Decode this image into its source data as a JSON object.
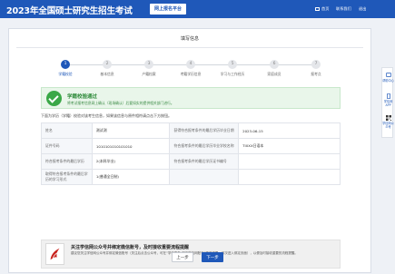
{
  "header": {
    "title": "2023年全国硕士研究生招生考试",
    "platform_badge": "网上报名平台",
    "nav": [
      {
        "label": "首页",
        "icon": "home-icon"
      },
      {
        "label": "联系我们",
        "icon": "contact-icon"
      },
      {
        "label": "退出",
        "icon": "logout-icon"
      }
    ]
  },
  "panel": {
    "title": "填写信息",
    "steps": [
      {
        "num": "1",
        "label": "学籍校验",
        "active": true
      },
      {
        "num": "2",
        "label": "基本信息",
        "active": false
      },
      {
        "num": "3",
        "label": "户籍档案",
        "active": false
      },
      {
        "num": "4",
        "label": "考籍学历信息",
        "active": false
      },
      {
        "num": "5",
        "label": "学习与工作经历",
        "active": false
      },
      {
        "num": "6",
        "label": "家庭成员",
        "active": false
      },
      {
        "num": "7",
        "label": "报考点",
        "active": false
      }
    ]
  },
  "success": {
    "title": "学籍校验通过",
    "desc": "将考试报考信息网上确认（现场确认）后要如实的提供相关部门进行。"
  },
  "hint": "下面为学历（学籍）校验对该考生信息，如果该信息与原件相符请点击下方按钮。",
  "info_table": [
    [
      "姓名",
      "测试测",
      "获得符合报考条件的最后学历毕业日期",
      "2023-06-15"
    ],
    [
      "证件号码",
      "1010101010101010",
      "符合报考条件的最后学历毕业学校名称",
      "TIXXX日语本"
    ],
    [
      "符合报考条件的最后学历",
      "2(本科毕业)",
      "符合报考条件的最后学历证书编号",
      ""
    ],
    [
      "取得符合报考条件的最后学历的学习形式",
      "1(普通全日制)",
      "",
      ""
    ]
  ],
  "notice": {
    "title": "关注学信网公众号并绑定微信账号，及时接收重要流程提醒",
    "body": "建议您关注学信网公众号并绑定微信账号（关注后点击公众号，可在“学信服务-绑定学信网账号”菜单栏里，依次进入绑定页面），以便及时接收重要的流程提醒。"
  },
  "buttons": {
    "prev": "上一步",
    "next": "下一步"
  },
  "side": [
    {
      "label": "帮助中心",
      "icon": "help-icon"
    },
    {
      "label": "学信网APP",
      "icon": "phone-icon"
    },
    {
      "label": "学信网公众号",
      "icon": "qrcode-icon"
    }
  ],
  "colors": {
    "primary": "#1f58b9",
    "success": "#3aa847",
    "background": "#eef1f6"
  }
}
